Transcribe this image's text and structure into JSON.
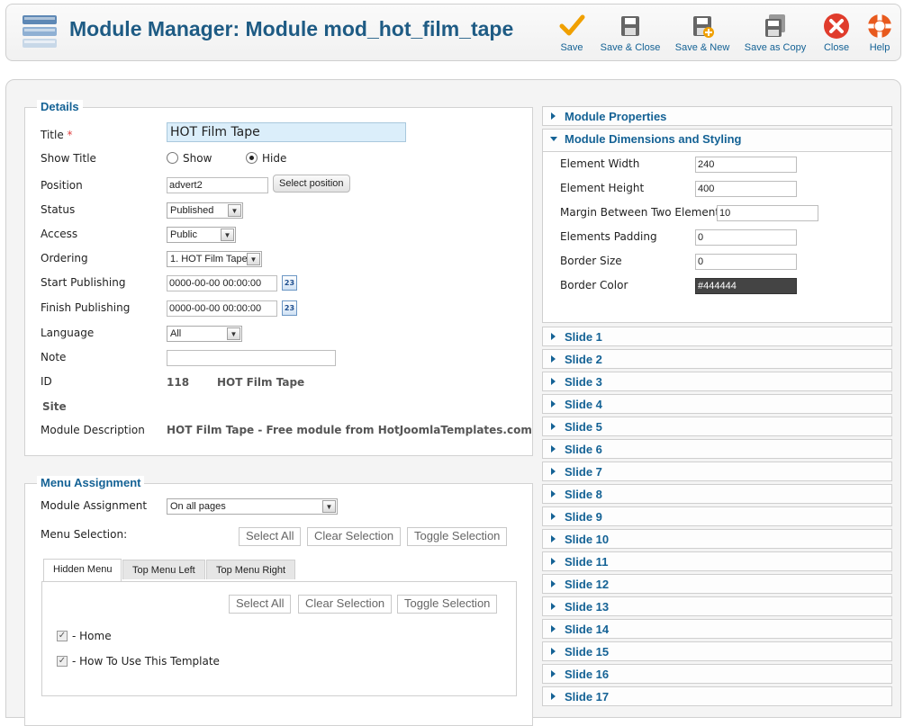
{
  "header": {
    "title": "Module Manager: Module mod_hot_film_tape",
    "icon": "module-icon"
  },
  "toolbar": {
    "save": "Save",
    "save_close": "Save & Close",
    "save_new": "Save & New",
    "save_copy": "Save as Copy",
    "close": "Close",
    "help": "Help"
  },
  "details": {
    "legend": "Details",
    "title_label": "Title",
    "required_mark": "*",
    "title_value": "HOT Film Tape",
    "show_title_label": "Show Title",
    "show_option": "Show",
    "hide_option": "Hide",
    "show_title_selected": "Hide",
    "position_label": "Position",
    "position_value": "advert2",
    "select_position": "Select position",
    "status_label": "Status",
    "status_value": "Published",
    "access_label": "Access",
    "access_value": "Public",
    "ordering_label": "Ordering",
    "ordering_value": "1. HOT Film Tape",
    "start_label": "Start Publishing",
    "start_value": "0000-00-00 00:00:00",
    "finish_label": "Finish Publishing",
    "finish_value": "0000-00-00 00:00:00",
    "calendar_icon_text": "23",
    "language_label": "Language",
    "language_value": "All",
    "note_label": "Note",
    "note_value": "",
    "id_label": "ID",
    "id_value": "118",
    "id_name": "HOT Film Tape",
    "site_label": "Site",
    "description_label": "Module Description",
    "description_value": "HOT Film Tape - Free module from HotJoomlaTemplates.com"
  },
  "menu_assignment": {
    "legend": "Menu Assignment",
    "assignment_label": "Module Assignment",
    "assignment_value": "On all pages",
    "selection_label": "Menu Selection:",
    "select_all": "Select All",
    "clear_selection": "Clear Selection",
    "toggle_selection": "Toggle Selection",
    "tabs": [
      "Hidden Menu",
      "Top Menu Left",
      "Top Menu Right"
    ],
    "items": [
      {
        "label": "- Home",
        "checked": true
      },
      {
        "label": "- How To Use This Template",
        "checked": true
      }
    ]
  },
  "right_panel": {
    "properties": "Module Properties",
    "dimensions": "Module Dimensions and Styling",
    "fields": [
      {
        "label": "Element Width",
        "value": "240"
      },
      {
        "label": "Element Height",
        "value": "400"
      },
      {
        "label": "Margin Between Two Elements",
        "value": "10"
      },
      {
        "label": "Elements Padding",
        "value": "0"
      },
      {
        "label": "Border Size",
        "value": "0"
      },
      {
        "label": "Border Color",
        "value": "#444444"
      }
    ],
    "border_color_swatch": "#444444",
    "slides": [
      "Slide 1",
      "Slide 2",
      "Slide 3",
      "Slide 4",
      "Slide 5",
      "Slide 6",
      "Slide 7",
      "Slide 8",
      "Slide 9",
      "Slide 10",
      "Slide 11",
      "Slide 12",
      "Slide 13",
      "Slide 14",
      "Slide 15",
      "Slide 16",
      "Slide 17"
    ]
  },
  "colors": {
    "accent": "#146295",
    "title_blue": "#1e5b84",
    "close_red": "#e03c2c",
    "save_orange": "#f0a000"
  }
}
